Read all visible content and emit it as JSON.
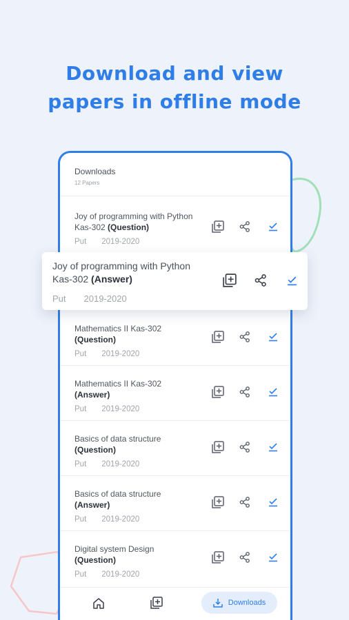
{
  "headline": {
    "line1": "Download and view",
    "line2": "papers in offline mode"
  },
  "downloads": {
    "title": "Downloads",
    "count": "12 Papers"
  },
  "papers": [
    {
      "title": "Joy of programming with Python Kas-302",
      "tag": "(Question)",
      "university": "Put",
      "year": "2019-2020"
    },
    {
      "title": "Mathematics II Kas-302",
      "tag": "(Question)",
      "university": "Put",
      "year": "2019-2020"
    },
    {
      "title": "Mathematics II Kas-302",
      "tag": "(Answer)",
      "university": "Put",
      "year": "2019-2020"
    },
    {
      "title": "Basics of data structure",
      "tag": "(Question)",
      "university": "Put",
      "year": "2019-2020"
    },
    {
      "title": "Basics of data structure",
      "tag": "(Answer)",
      "university": "Put",
      "year": "2019-2020"
    },
    {
      "title": "Digital system Design",
      "tag": "(Question)",
      "university": "Put",
      "year": "2019-2020"
    }
  ],
  "highlighted": {
    "title": "Joy of programming with Python Kas-302",
    "tag": "(Answer)",
    "university": "Put",
    "year": "2019-2020"
  },
  "bottom_nav": {
    "downloads_label": "Downloads"
  },
  "icons": {
    "add": "add-to-library-icon",
    "share": "share-icon",
    "downloaded": "downloaded-check-icon",
    "home": "home-icon",
    "library": "library-icon"
  },
  "colors": {
    "accent": "#2f7ee8",
    "background": "#eef2fa",
    "deco_green": "#9fe0b8",
    "deco_pink": "#f6c6c8"
  }
}
